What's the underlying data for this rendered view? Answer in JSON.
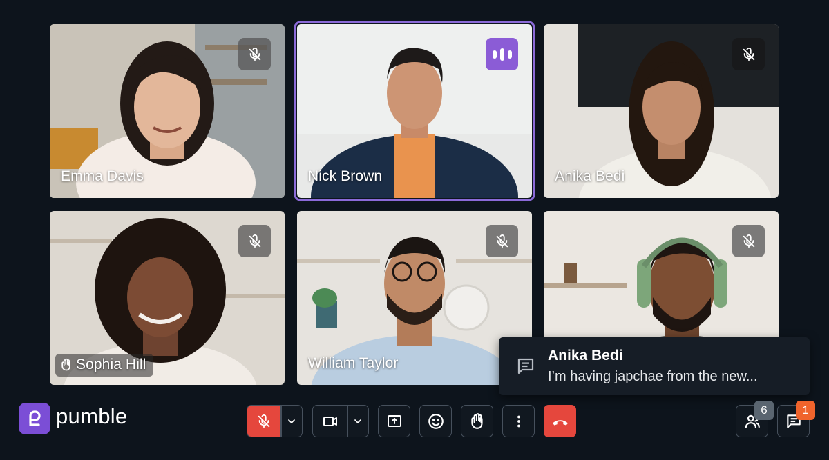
{
  "participants": [
    {
      "name": "Emma Davis",
      "muted": true
    },
    {
      "name": "Nick Brown",
      "speaking": true
    },
    {
      "name": "Anika Bedi",
      "muted": true
    },
    {
      "name": "Sophia Hill",
      "muted": true,
      "hand_raised": true
    },
    {
      "name": "William Taylor",
      "muted": true
    },
    {
      "name": "",
      "muted": true
    }
  ],
  "toast": {
    "sender": "Anika Bedi",
    "message": "I’m having japchae from the new..."
  },
  "brand": {
    "logo_text": "pumble",
    "color": "#7b4ed6"
  },
  "controls": {
    "participants_count": "6",
    "chat_unread": "1"
  },
  "colors": {
    "accent": "#8b5cd6",
    "mic_off": "#e5473d",
    "leave": "#e5473d",
    "unread_badge": "#f0642c",
    "count_badge": "#5a6570"
  },
  "icons": [
    "mic-off-icon",
    "chevron-down-icon",
    "video-camera-icon",
    "share-screen-icon",
    "emoji-icon",
    "raise-hand-icon",
    "more-vertical-icon",
    "hang-up-icon",
    "participants-icon",
    "chat-icon",
    "speaking-icon",
    "message-icon"
  ]
}
